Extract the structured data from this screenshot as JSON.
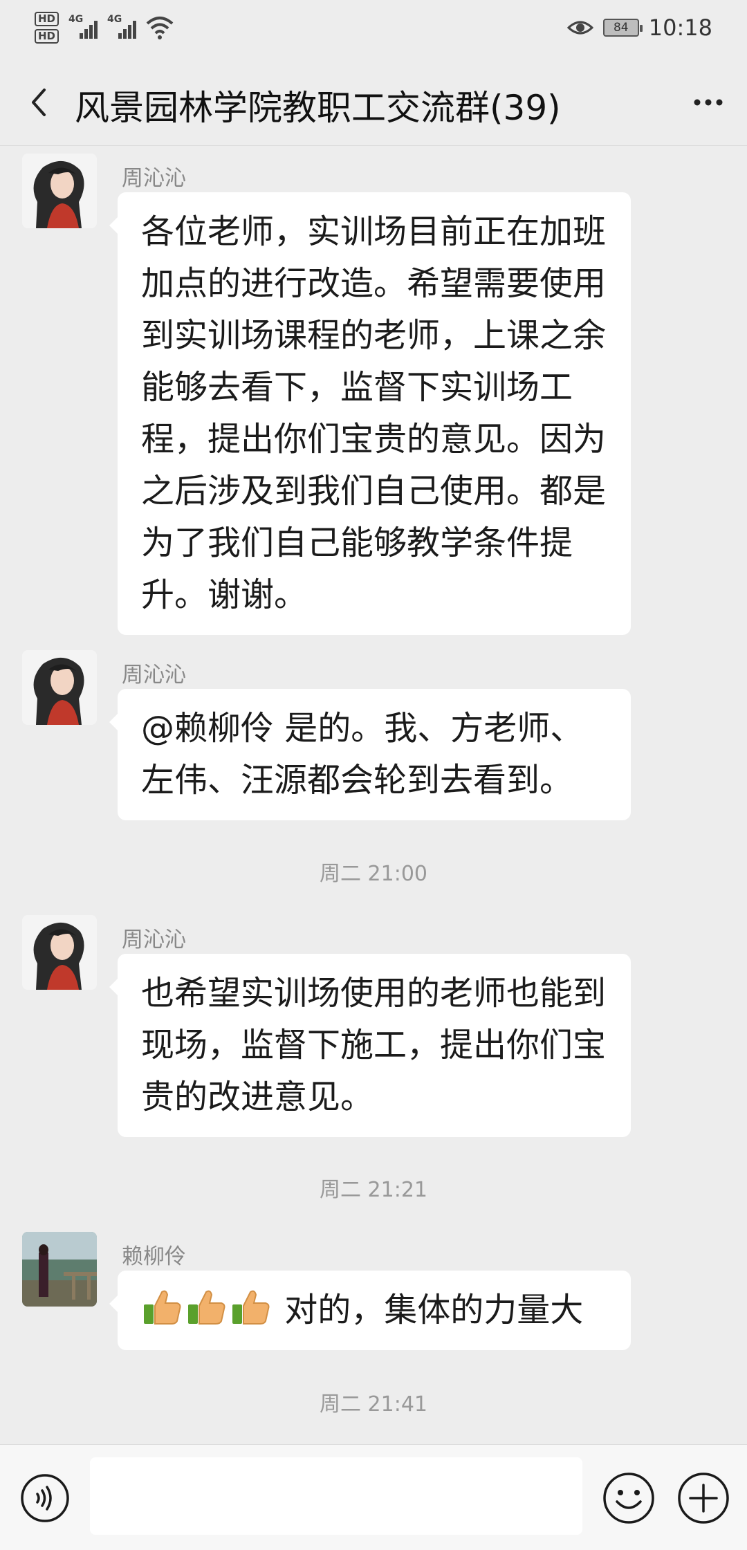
{
  "status_bar": {
    "hd1": "HD",
    "hd2": "HD",
    "net1": "4G",
    "net2": "4G",
    "battery": "84",
    "time": "10:18"
  },
  "header": {
    "title": "风景园林学院教职工交流群(39)"
  },
  "messages": [
    {
      "sender": "周沁沁",
      "text": "各位老师，实训场目前正在加班加点的进行改造。希望需要使用到实训场课程的老师，上课之余能够去看下，监督下实训场工程，提出你们宝贵的意见。因为之后涉及到我们自己使用。都是为了我们自己能够教学条件提升。谢谢。"
    },
    {
      "sender": "周沁沁",
      "text": "@赖柳伶  是的。我、方老师、左伟、汪源都会轮到去看到。"
    },
    {
      "sender": "周沁沁",
      "text": "也希望实训场使用的老师也能到现场，监督下施工，提出你们宝贵的改进意见。"
    },
    {
      "sender": "赖柳伶",
      "text": "对的，集体的力量大",
      "emoji": "thumbs-up x3"
    }
  ],
  "timestamps": [
    "周二 21:00",
    "周二 21:21",
    "周二 21:41"
  ],
  "icons": {
    "back": "chevron-left-icon",
    "more": "more-dots-icon",
    "voice": "voice-icon",
    "emoji": "emoji-icon",
    "plus": "plus-icon"
  },
  "colors": {
    "background": "#ededed",
    "bubble": "#ffffff",
    "meta_text": "#999999"
  }
}
